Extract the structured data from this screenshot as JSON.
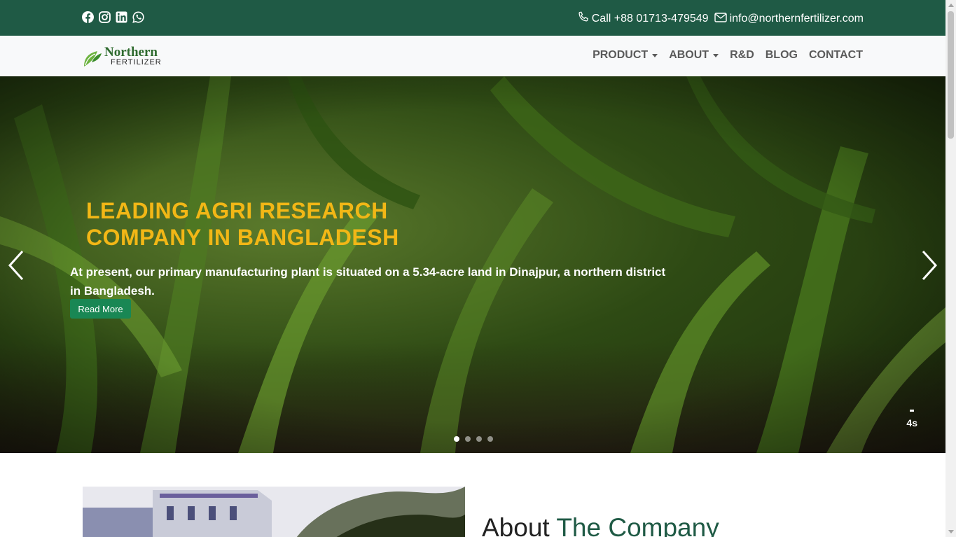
{
  "topbar": {
    "social": [
      {
        "icon": "facebook-icon"
      },
      {
        "icon": "instagram-icon"
      },
      {
        "icon": "linkedin-icon"
      },
      {
        "icon": "whatsapp-icon"
      }
    ],
    "phone_label": "Call +88 01713-479549",
    "email_label": "info@northernfertilizer.com"
  },
  "logo": {
    "line1": "Northern",
    "line2": "FERTILIZER"
  },
  "nav": {
    "items": [
      {
        "label": "PRODUCT",
        "dropdown": true
      },
      {
        "label": "ABOUT",
        "dropdown": true
      },
      {
        "label": "R&D",
        "dropdown": false
      },
      {
        "label": "BLOG",
        "dropdown": false
      },
      {
        "label": "CONTACT",
        "dropdown": false
      }
    ]
  },
  "hero": {
    "heading_line1": "LEADING AGRI RESEARCH",
    "heading_line2": "COMPANY IN BANGLADESH",
    "description": "At present, our primary manufacturing plant is situated on a 5.34-acre land in Dinajpur, a northern district in Bangladesh.",
    "button_label": "Read More",
    "timer": "4s",
    "slide_count": 4,
    "active_slide": 1
  },
  "about": {
    "title_plain": "About",
    "title_accent": "The Company"
  },
  "colors": {
    "brand_green": "#1f5a45",
    "heading_yellow": "#f2b716",
    "button_green": "#198754"
  }
}
